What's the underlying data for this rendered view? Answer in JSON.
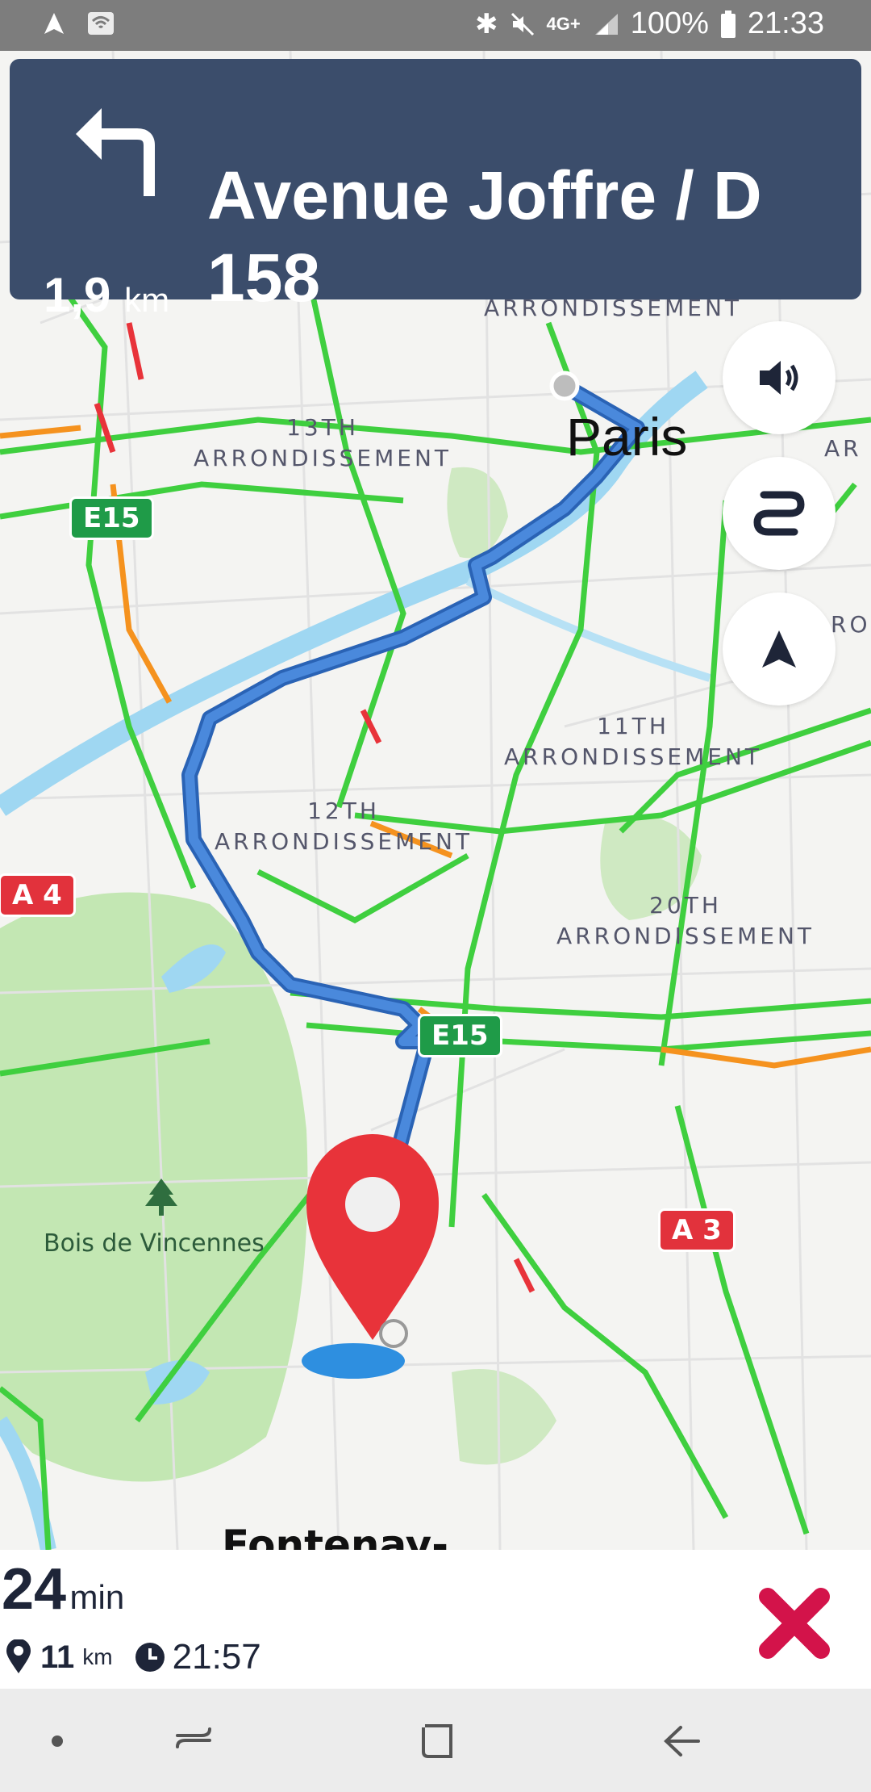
{
  "status_bar": {
    "battery": "100%",
    "time": "21:33",
    "network": "4G+",
    "icons": [
      "navigation-arrow-icon",
      "wifi-icon",
      "bluetooth-icon",
      "mute-icon",
      "signal-icon",
      "battery-icon"
    ]
  },
  "navigation": {
    "distance_value": "1,9",
    "distance_unit": "km",
    "street_line1": "Avenue Joffre / D",
    "street_line2": "158",
    "turn": "turn-left-icon"
  },
  "map": {
    "city": "Paris",
    "districts": [
      {
        "line1": "13TH",
        "line2": "ARRONDISSEMENT"
      },
      {
        "line1": "11TH",
        "line2": "ARRONDISSEMENT"
      },
      {
        "line1": "12TH",
        "line2": "ARRONDISSEMENT"
      },
      {
        "line1": "20TH",
        "line2": "ARRONDISSEMENT"
      }
    ],
    "top_partial_label": "ARRONDISSEMENT",
    "right_partial_1": "AR",
    "right_partial_2": "RO",
    "park": "Bois de Vincennes",
    "bottom_partial_city": "Fontenay-",
    "shields": {
      "e15_left": "E15",
      "e15_center": "E15",
      "a4": "A 4",
      "a3": "A 3"
    },
    "colors": {
      "route": "#4a89dc",
      "traffic_free": "#3fcf3f",
      "traffic_slow": "#f5921e",
      "traffic_jam": "#e8333a",
      "river": "#9fd7f2",
      "park": "#c3e7b3"
    }
  },
  "controls": {
    "volume": "volume-icon",
    "route_options": "route-icon",
    "recenter": "navigation-arrow-icon"
  },
  "trip": {
    "minutes": "24",
    "minutes_unit": "min",
    "distance": "11",
    "distance_unit": "km",
    "arrival": "21:57"
  },
  "system_nav": {
    "buttons": [
      "dot-icon",
      "recent-apps-icon",
      "home-icon",
      "back-icon"
    ]
  }
}
